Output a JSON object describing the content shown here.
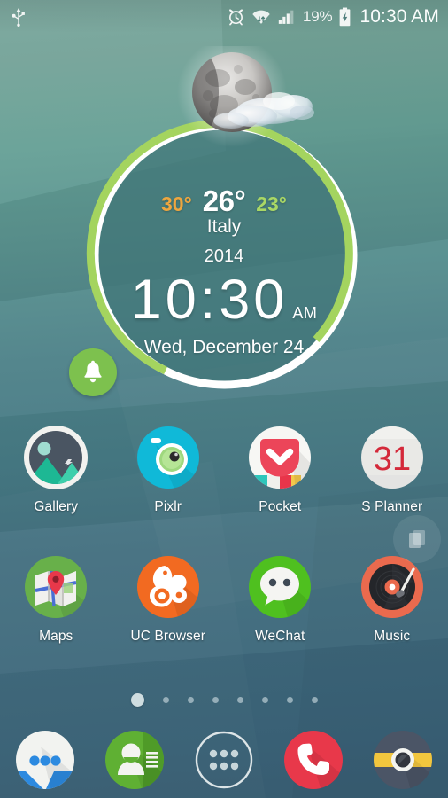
{
  "statusbar": {
    "usb_icon": "usb-icon",
    "alarm_icon": "alarm-clock-icon",
    "wifi_icon": "wifi-icon",
    "signal_icon": "cellular-signal-icon",
    "battery_percent": "19%",
    "battery_icon": "battery-charging-icon",
    "clock": "10:30 AM"
  },
  "widget": {
    "weather_icon": "moon-cloud-icon",
    "temp_high": "30°",
    "temp_current": "26°",
    "temp_low": "23°",
    "location": "Italy",
    "year": "2014",
    "time": "10:30",
    "ampm": "AM",
    "date": "Wed, December 24",
    "ring_progress_color": "#a4d45f",
    "ring_track_color": "#ffffff",
    "dial_color": "#3e7476",
    "high_color": "#eda63f",
    "low_color": "#a9d765"
  },
  "notification_badge": {
    "icon": "bell-icon",
    "color": "#7dc14e"
  },
  "apps": [
    [
      {
        "label": "Gallery",
        "icon": "gallery-icon"
      },
      {
        "label": "Pixlr",
        "icon": "pixlr-icon"
      },
      {
        "label": "Pocket",
        "icon": "pocket-icon"
      },
      {
        "label": "S Planner",
        "icon": "s-planner-icon",
        "day": "31"
      }
    ],
    [
      {
        "label": "Maps",
        "icon": "maps-icon"
      },
      {
        "label": "UC Browser",
        "icon": "uc-browser-icon"
      },
      {
        "label": "WeChat",
        "icon": "wechat-icon"
      },
      {
        "label": "Music",
        "icon": "music-icon"
      }
    ]
  ],
  "pages_button": {
    "icon": "pages-icon"
  },
  "page_indicator": {
    "count": 8,
    "active_index": 0
  },
  "dock": [
    {
      "name": "messages",
      "icon": "messages-icon"
    },
    {
      "name": "contacts",
      "icon": "contacts-icon"
    },
    {
      "name": "app-drawer",
      "icon": "apps-grid-icon"
    },
    {
      "name": "phone",
      "icon": "phone-icon"
    },
    {
      "name": "camera",
      "icon": "camera-icon"
    }
  ]
}
